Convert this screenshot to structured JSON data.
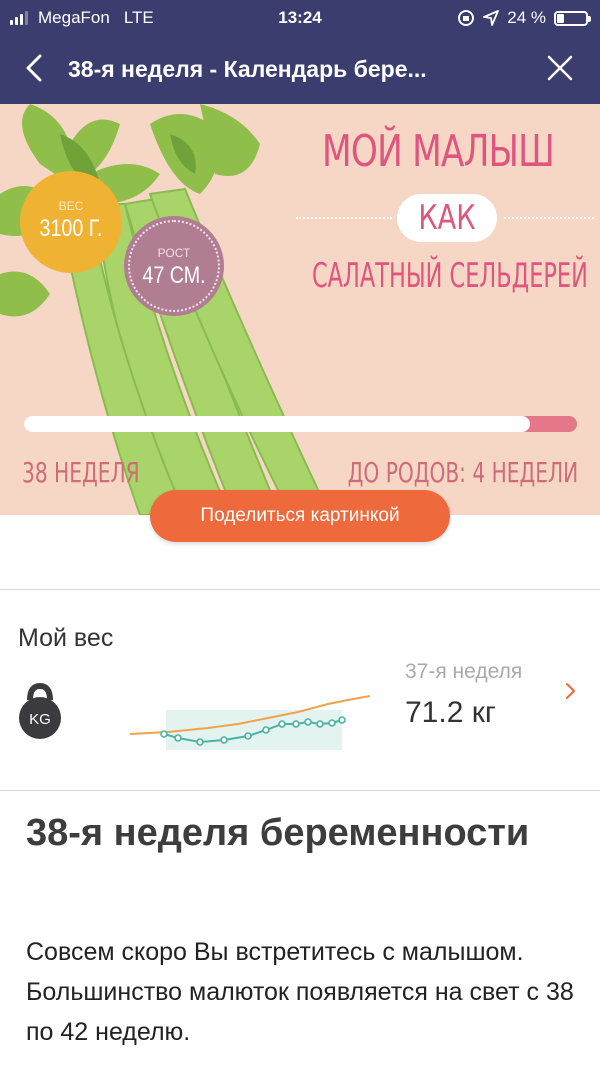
{
  "status_bar": {
    "carrier": "MegaFon",
    "network": "LTE",
    "time": "13:24",
    "battery": "24 %",
    "battery_level": 0.24
  },
  "nav": {
    "title": "38-я неделя - Календарь бере..."
  },
  "hero": {
    "title": "МОЙ МАЛЫШ",
    "kak": "КАК",
    "subtitle": "САЛАТНЫЙ СЕЛЬДЕРЕЙ",
    "weight_label": "ВЕС",
    "weight_value": "3100 Г.",
    "height_label": "РОСТ",
    "height_value": "47 СМ.",
    "progress": 0.915,
    "week_label": "38 НЕДЕЛЯ",
    "left_label": "ДО РОДОВ: 4 НЕДЕЛИ",
    "share_label": "Поделиться картинкой",
    "colors": {
      "bg": "#f6d6c4",
      "accent": "#e0557d",
      "weight_badge": "#f0b233",
      "height_badge": "#b07d93",
      "button": "#ee6a3c"
    }
  },
  "weight_card": {
    "title": "Мой вес",
    "icon_label": "KG",
    "previous_week": "37-я неделя",
    "current_weight": "71.2 кг"
  },
  "article": {
    "title": "38-я неделя беременности",
    "body": "Совсем скоро Вы встретитесь с малышом. Большинство малюток появляется на свет с 38 по 42 неделю."
  }
}
